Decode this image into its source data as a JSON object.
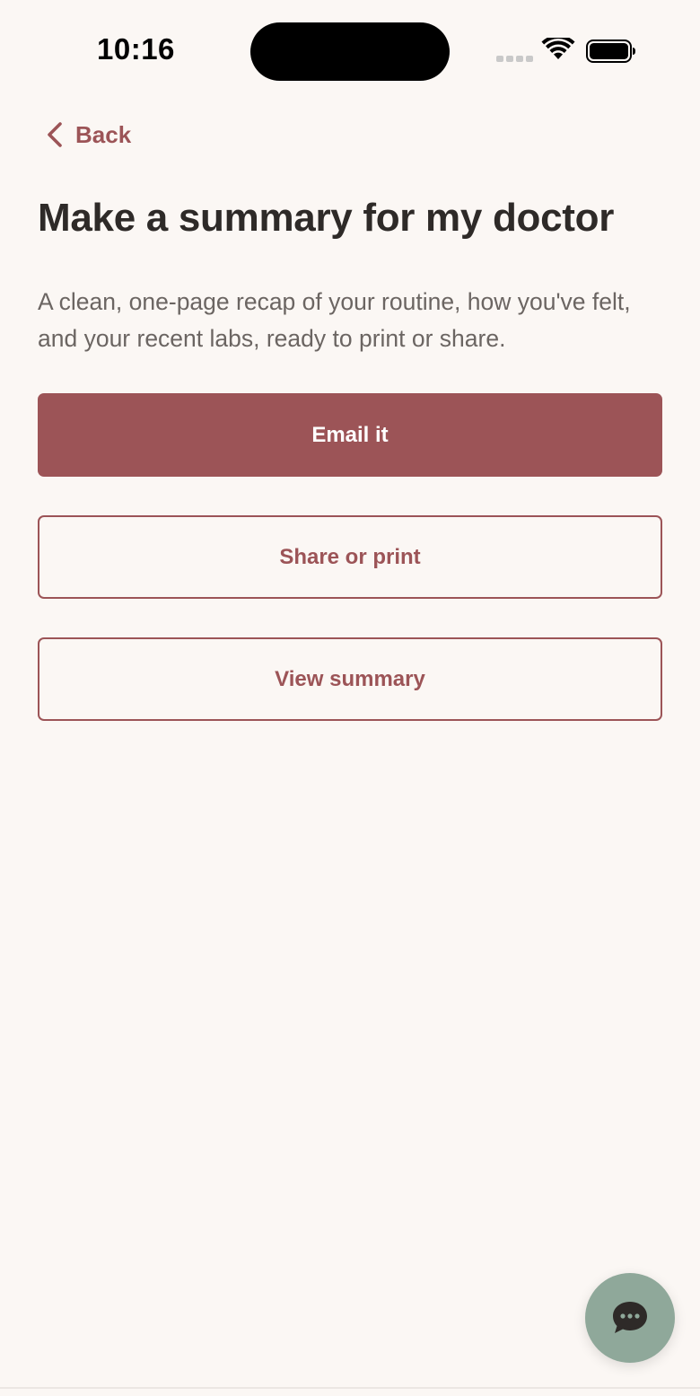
{
  "status_bar": {
    "time": "10:16"
  },
  "nav": {
    "back_label": "Back"
  },
  "page": {
    "title": "Make a summary for my doctor",
    "subtitle": "A clean, one-page recap of your routine, how you've felt, and your recent labs, ready to print or share."
  },
  "actions": {
    "email_label": "Email it",
    "share_label": "Share or print",
    "view_label": "View summary"
  },
  "icons": {
    "back": "chevron-left-icon",
    "wifi": "wifi-icon",
    "battery": "battery-icon",
    "signal": "cellular-signal-icon",
    "chat": "chat-bubble-icon"
  },
  "colors": {
    "background": "#FBF7F4",
    "accent": "#9C5457",
    "title_text": "#2E2A28",
    "body_text": "#6B6562",
    "chat_button": "#8FA89A"
  }
}
